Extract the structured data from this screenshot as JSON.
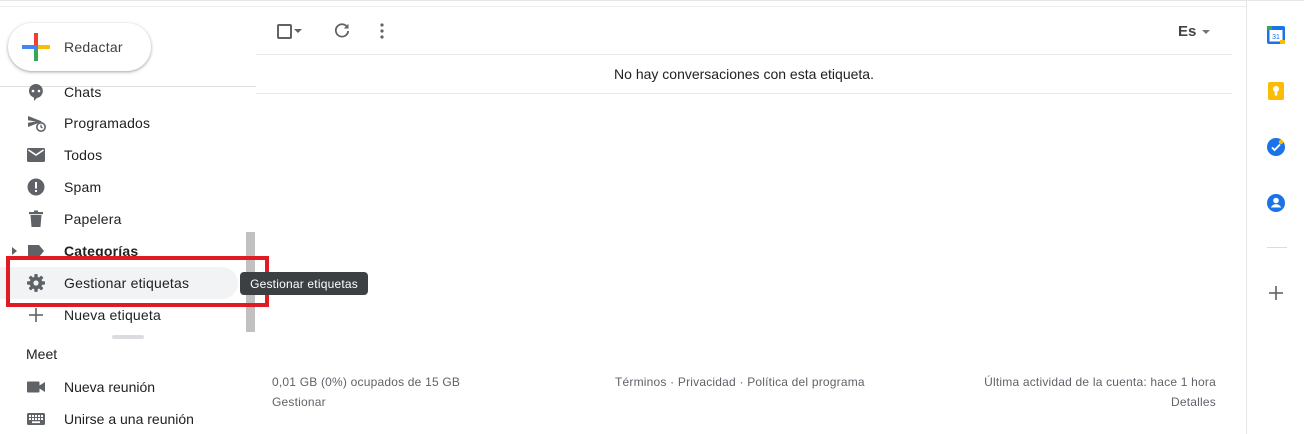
{
  "compose": {
    "label": "Redactar"
  },
  "sidebar": {
    "items": [
      {
        "label": "Chats",
        "icon": "chat-icon"
      },
      {
        "label": "Programados",
        "icon": "scheduled-send-icon"
      },
      {
        "label": "Todos",
        "icon": "mail-icon"
      },
      {
        "label": "Spam",
        "icon": "report-spam-icon"
      },
      {
        "label": "Papelera",
        "icon": "trash-icon"
      },
      {
        "label": "Categorías",
        "icon": "label-icon"
      },
      {
        "label": "Gestionar etiquetas",
        "icon": "gear-icon"
      },
      {
        "label": "Nueva etiqueta",
        "icon": "plus-icon"
      }
    ]
  },
  "tooltip": {
    "text": "Gestionar etiquetas"
  },
  "meet": {
    "title": "Meet",
    "items": [
      {
        "label": "Nueva reunión",
        "icon": "video-camera-icon"
      },
      {
        "label": "Unirse a una reunión",
        "icon": "keyboard-icon"
      }
    ]
  },
  "toolbar": {
    "language": "Es"
  },
  "main": {
    "empty_message": "No hay conversaciones con esta etiqueta."
  },
  "footer": {
    "storage": "0,01 GB (0%) ocupados de 15 GB",
    "manage": "Gestionar",
    "terms": "Términos",
    "privacy": "Privacidad",
    "policy": "Política del programa",
    "separator": " · ",
    "last_activity": "Última actividad de la cuenta: hace 1 hora",
    "details": "Detalles"
  },
  "side_panel": {
    "apps": [
      "calendar-icon",
      "keep-icon",
      "tasks-icon",
      "contacts-icon",
      "add-icon"
    ],
    "calendar_day": "31"
  },
  "colors": {
    "highlight": "#e01b24",
    "tooltip_bg": "#3c4043",
    "calendar": "#1a73e8",
    "keep": "#fbbc04",
    "tasks": "#1a73e8",
    "contacts": "#1a73e8"
  }
}
